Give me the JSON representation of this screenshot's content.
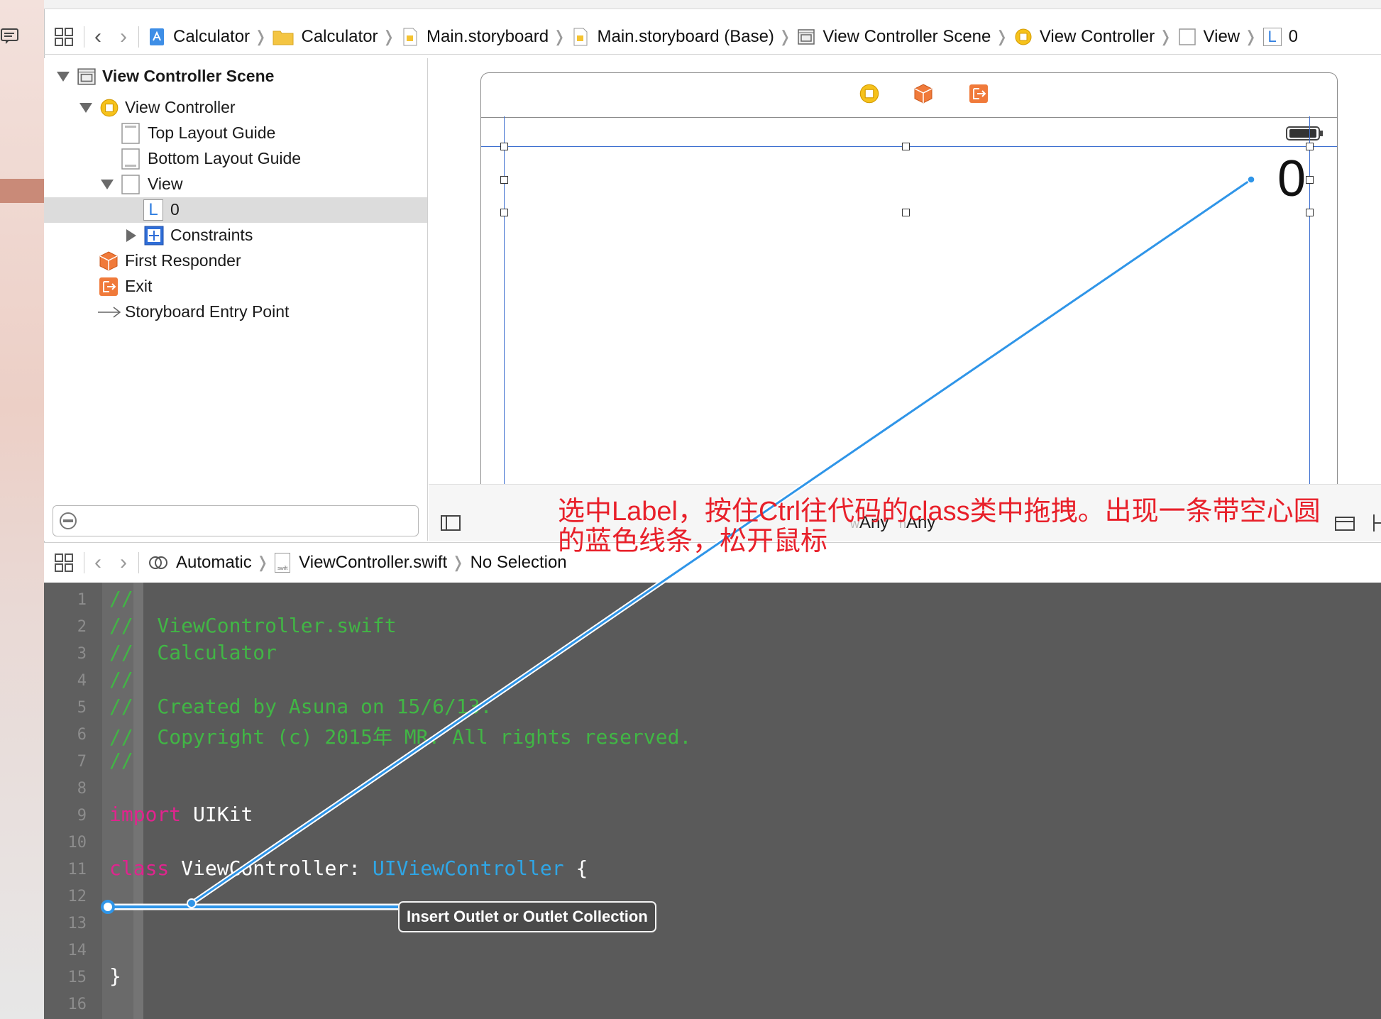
{
  "jumpbar_top": {
    "crumbs": [
      "Calculator",
      "Calculator",
      "Main.storyboard",
      "Main.storyboard (Base)",
      "View Controller Scene",
      "View Controller",
      "View",
      "0"
    ]
  },
  "outline": {
    "scene": "View Controller Scene",
    "view_controller": "View Controller",
    "top_guide": "Top Layout Guide",
    "bottom_guide": "Bottom Layout Guide",
    "view": "View",
    "label_item": "0",
    "constraints": "Constraints",
    "first_responder": "First Responder",
    "exit": "Exit",
    "entry_point": "Storyboard Entry Point",
    "label_icon_letter": "L"
  },
  "canvas": {
    "label_text": "0",
    "size_class_w_prefix": "w",
    "size_class_w": "Any",
    "size_class_h_prefix": "h",
    "size_class_h": "Any"
  },
  "annotation": {
    "line1": "选中Label，按住Ctrl往代码的class类中拖拽。出现一条带空心圆",
    "line2": "的蓝色线条，松开鼠标"
  },
  "jumpbar_bottom": {
    "automatic": "Automatic",
    "file": "ViewController.swift",
    "selection": "No Selection",
    "swift_badge": "swift"
  },
  "code": {
    "line_numbers": [
      "1",
      "2",
      "3",
      "4",
      "5",
      "6",
      "7",
      "8",
      "9",
      "10",
      "11",
      "12",
      "13",
      "14",
      "15",
      "16"
    ],
    "l1": "//",
    "l2": "//  ViewController.swift",
    "l3": "//  Calculator",
    "l4": "//",
    "l5": "//  Created by Asuna on 15/6/13.",
    "l6": "//  Copyright (c) 2015年 MR. All rights reserved.",
    "l7": "//",
    "l9_kw": "import",
    "l9_rest": " UIKit",
    "l11_kw": "class",
    "l11_name": " ViewController: ",
    "l11_super": "UIViewController",
    "l11_brace": " {",
    "l15": "}"
  },
  "tooltip": "Insert Outlet or Outlet Collection",
  "colors": {
    "accent_blue": "#2f95e8",
    "annotation_red": "#e8202a",
    "code_bg": "#5a5a5a",
    "comment_green": "#41b645",
    "keyword_pink": "#e0248e",
    "system_type_blue": "#2fa6e6"
  }
}
